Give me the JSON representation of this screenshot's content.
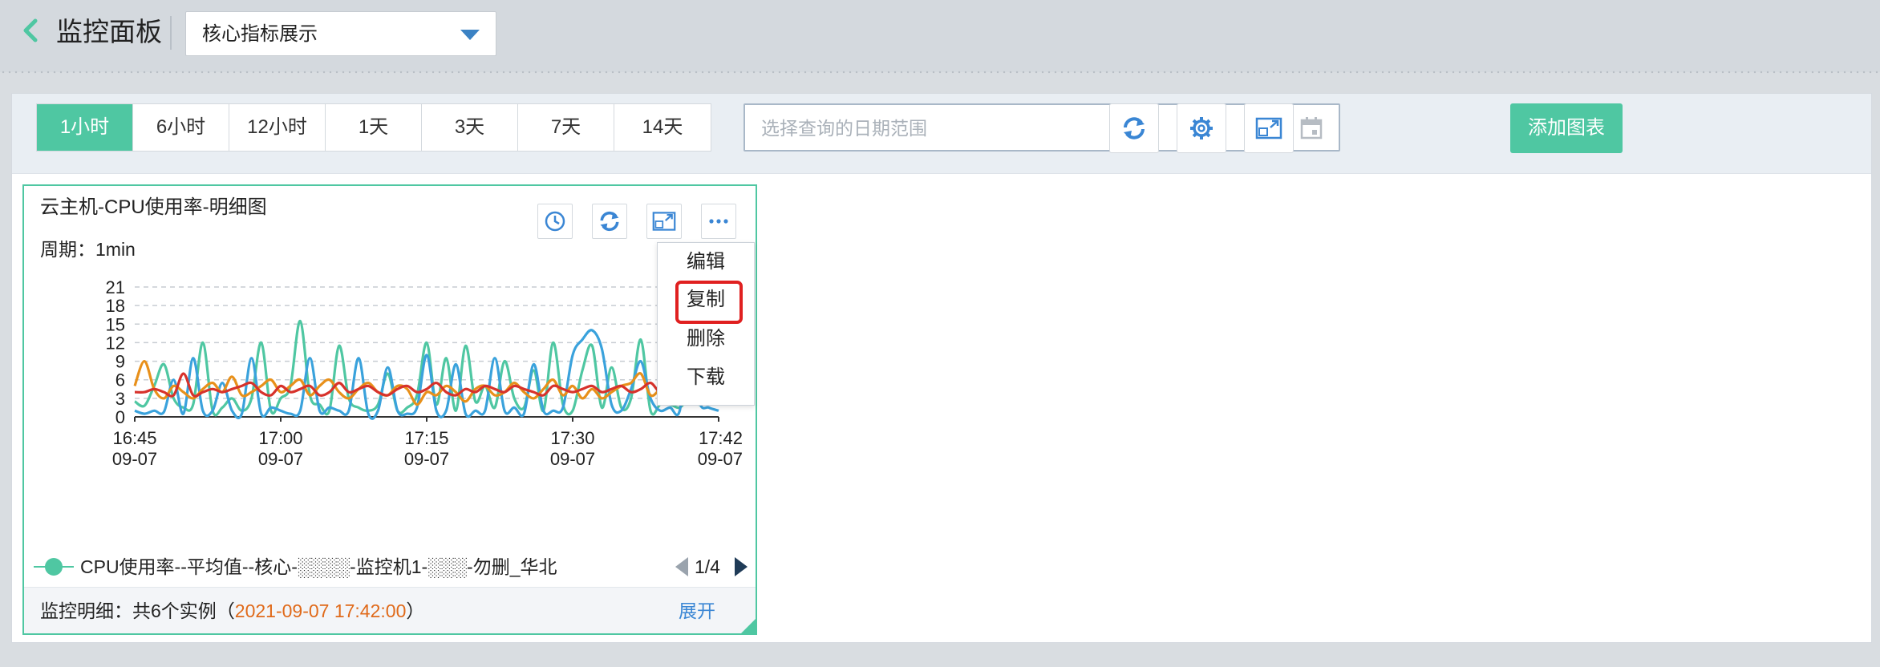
{
  "header": {
    "title": "监控面板",
    "dashboard_select": "核心指标展示"
  },
  "toolbar": {
    "time_ranges": [
      "1小时",
      "6小时",
      "12小时",
      "1天",
      "3天",
      "7天",
      "14天"
    ],
    "active_range": "1小时",
    "date_placeholder": "选择查询的日期范围",
    "add_chart_label": "添加图表"
  },
  "card": {
    "title": "云主机-CPU使用率-明细图",
    "period": "周期：1min",
    "legend_text": "CPU使用率--平均值--核心-░░░░-监控机1-░░░-勿删_华北",
    "legend_page": "1/4",
    "footer_prefix": "监控明细：共6个实例（",
    "footer_time": "2021-09-07 17:42:00",
    "footer_suffix": "）",
    "expand_label": "展开"
  },
  "menu": {
    "items": [
      "编辑",
      "复制",
      "删除",
      "下载"
    ],
    "highlighted": "复制"
  },
  "colors": {
    "accent": "#4fc7a2",
    "series_teal": "#4fc7a2",
    "series_blue": "#3aa2dc",
    "series_orange": "#e8901a",
    "series_red": "#d7322b",
    "footer_time": "#e06a1a",
    "link": "#3a86d4",
    "highlight_box": "#e02020"
  },
  "chart_data": {
    "type": "line",
    "ylim": [
      0,
      21
    ],
    "yticks": [
      0,
      3,
      6,
      9,
      12,
      15,
      18,
      21
    ],
    "x_ticks": [
      {
        "time": "16:45",
        "date": "09-07"
      },
      {
        "time": "17:00",
        "date": "09-07"
      },
      {
        "time": "17:15",
        "date": "09-07"
      },
      {
        "time": "17:30",
        "date": "09-07"
      },
      {
        "time": "17:42",
        "date": "09-07"
      }
    ],
    "x": [
      0,
      1,
      2,
      3,
      4,
      5,
      6,
      7,
      8,
      9,
      10,
      11,
      12,
      13,
      14,
      15,
      16,
      17,
      18,
      19,
      20,
      21,
      22,
      23,
      24,
      25,
      26,
      27,
      28,
      29,
      30,
      31,
      32,
      33,
      34,
      35,
      36,
      37,
      38,
      39,
      40,
      41,
      42,
      43,
      44,
      45,
      46,
      47,
      48,
      49,
      50,
      51,
      52,
      53,
      54,
      55,
      56,
      57,
      58,
      59,
      60
    ],
    "series": [
      {
        "color": "#4fc7a2",
        "values": [
          2.5,
          1.8,
          5.0,
          8.5,
          3.0,
          1.5,
          2.0,
          12.0,
          1.0,
          1.5,
          3.0,
          1.0,
          3.0,
          12.0,
          1.0,
          3.0,
          5.0,
          15.5,
          3.5,
          2.0,
          1.0,
          11.5,
          3.0,
          1.5,
          1.0,
          2.0,
          7.0,
          1.0,
          1.5,
          3.5,
          12.0,
          2.0,
          9.5,
          1.0,
          11.5,
          2.5,
          5.0,
          1.5,
          9.0,
          3.0,
          1.5,
          7.5,
          1.0,
          12.0,
          2.0,
          1.0,
          7.5,
          11.5,
          1.5,
          8.0,
          1.5,
          3.0,
          12.5,
          1.0,
          2.0,
          2.0,
          1.5,
          3.0,
          2.0,
          3.5,
          2.0
        ]
      },
      {
        "color": "#3aa2dc",
        "values": [
          1.0,
          0.5,
          1.0,
          0.8,
          6.0,
          0.5,
          9.5,
          1.0,
          1.0,
          5.5,
          1.0,
          0.5,
          9.5,
          0.5,
          1.5,
          1.0,
          0.5,
          1.0,
          9.5,
          1.0,
          1.5,
          1.0,
          1.0,
          9.5,
          0.5,
          1.0,
          8.0,
          1.0,
          0.5,
          1.5,
          10.0,
          1.0,
          1.0,
          8.5,
          0.5,
          1.0,
          1.0,
          9.5,
          1.0,
          1.5,
          0.5,
          8.5,
          1.0,
          1.0,
          1.5,
          10.0,
          12.5,
          14.0,
          11.0,
          2.0,
          1.0,
          4.5,
          9.0,
          3.0,
          1.0,
          1.5,
          1.0,
          12.5,
          2.5,
          1.5,
          1.0
        ]
      },
      {
        "color": "#e8901a",
        "values": [
          5.0,
          9.0,
          4.5,
          3.0,
          5.0,
          4.0,
          3.0,
          4.5,
          5.5,
          4.0,
          6.5,
          3.5,
          4.0,
          5.0,
          6.0,
          4.0,
          5.0,
          6.0,
          3.5,
          5.0,
          6.0,
          4.0,
          3.0,
          4.5,
          5.5,
          4.0,
          3.5,
          5.0,
          4.5,
          2.0,
          4.0,
          3.5,
          5.0,
          4.0,
          2.5,
          4.5,
          5.0,
          3.5,
          4.0,
          5.5,
          4.0,
          3.0,
          4.5,
          6.0,
          3.5,
          5.0,
          3.0,
          4.5,
          3.0,
          4.0,
          5.0,
          5.5,
          7.0,
          3.5,
          4.5,
          5.5,
          6.5,
          4.0,
          5.5,
          3.0,
          4.0
        ]
      },
      {
        "color": "#d7322b",
        "values": [
          4.0,
          4.0,
          4.5,
          4.0,
          3.5,
          7.0,
          3.5,
          4.0,
          4.5,
          4.0,
          4.5,
          5.0,
          5.5,
          4.0,
          3.5,
          5.0,
          4.0,
          4.5,
          5.0,
          3.5,
          4.0,
          5.5,
          4.0,
          4.5,
          5.0,
          4.0,
          3.5,
          4.5,
          5.0,
          4.0,
          4.5,
          5.5,
          4.0,
          3.5,
          4.5,
          4.0,
          5.0,
          4.5,
          4.0,
          5.0,
          4.5,
          4.0,
          3.5,
          5.0,
          4.5,
          4.0,
          4.5,
          5.0,
          4.0,
          4.5,
          5.0,
          4.0,
          4.5,
          5.5,
          4.0,
          5.0,
          4.5,
          3.5,
          4.5,
          3.0,
          4.0
        ]
      }
    ]
  }
}
